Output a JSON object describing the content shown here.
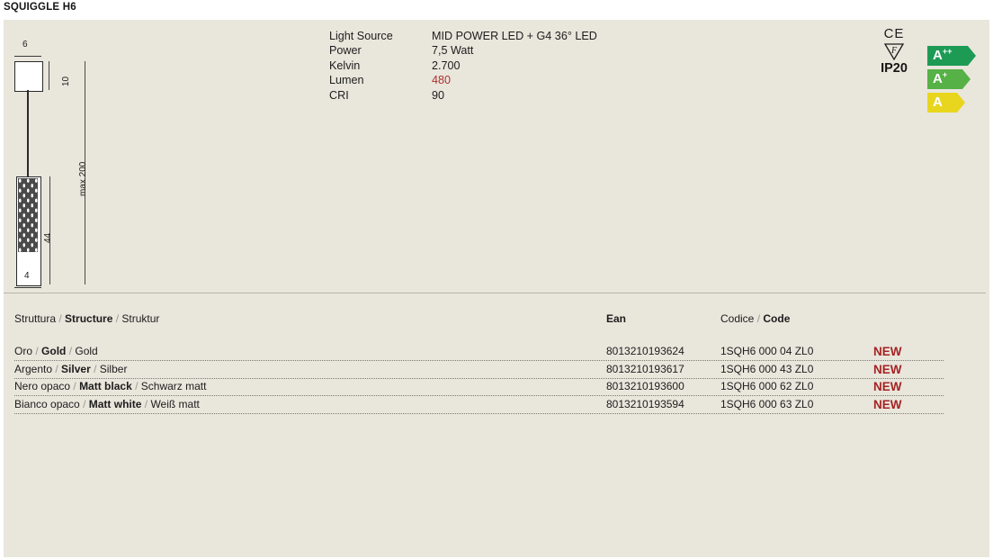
{
  "document": {
    "title": "SQUIGGLE H6"
  },
  "drawing": {
    "dim_width_top": "6",
    "dim_height_canopy": "10",
    "dim_height_body": "44",
    "dim_max_drop": "max 200",
    "dim_width_bottom": "4"
  },
  "specs": [
    {
      "label": "Light Source",
      "value": "MID POWER LED + G4 36° LED",
      "highlight": false
    },
    {
      "label": "Power",
      "value": "7,5 Watt",
      "highlight": false
    },
    {
      "label": "Kelvin",
      "value": "2.700",
      "highlight": false
    },
    {
      "label": "Lumen",
      "value": "480",
      "highlight": true
    },
    {
      "label": "CRI",
      "value": "90",
      "highlight": false
    }
  ],
  "marks": {
    "ce": "CE",
    "f_mark": "F",
    "ip_rating": "IP20"
  },
  "energy_labels": [
    {
      "letter": "A",
      "plus": "++",
      "color": "#1d9b55"
    },
    {
      "letter": "A",
      "plus": "+",
      "color": "#56b146"
    },
    {
      "letter": "A",
      "plus": "",
      "color": "#e8d61e"
    }
  ],
  "table": {
    "headers": {
      "structure_it": "Struttura",
      "structure_en": "Structure",
      "structure_de": "Struktur",
      "ean": "Ean",
      "code_it": "Codice",
      "code_en": "Code"
    },
    "rows": [
      {
        "name_it": "Oro",
        "name_en": "Gold",
        "name_de": "Gold",
        "ean": "8013210193624",
        "code": "1SQH6 000 04 ZL0",
        "badge": "NEW"
      },
      {
        "name_it": "Argento",
        "name_en": "Silver",
        "name_de": "Silber",
        "ean": "8013210193617",
        "code": "1SQH6 000 43 ZL0",
        "badge": "NEW"
      },
      {
        "name_it": "Nero opaco",
        "name_en": "Matt black",
        "name_de": "Schwarz matt",
        "ean": "8013210193600",
        "code": "1SQH6 000 62 ZL0",
        "badge": "NEW"
      },
      {
        "name_it": "Bianco opaco",
        "name_en": "Matt white",
        "name_de": "Weiß matt",
        "ean": "8013210193594",
        "code": "1SQH6 000 63 ZL0",
        "badge": "NEW"
      }
    ]
  },
  "colors": {
    "panel_background": "#e9e6dc",
    "highlight_red": "#b03030",
    "badge_red": "#a32424"
  }
}
